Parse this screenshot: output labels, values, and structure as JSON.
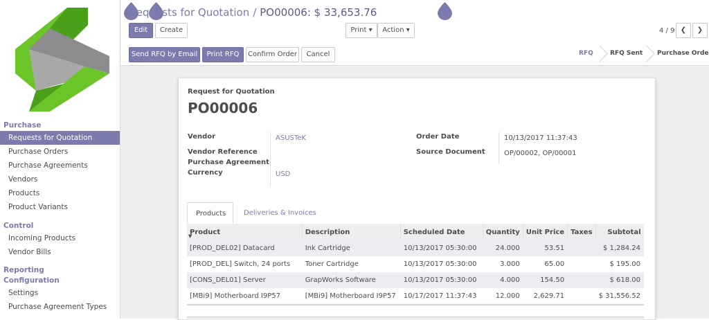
{
  "sidebar": {
    "sections": [
      {
        "title": "Purchase",
        "items": [
          {
            "label": "Requests for Quotation",
            "active": true
          },
          {
            "label": "Purchase Orders",
            "active": false
          },
          {
            "label": "Purchase Agreements",
            "active": false
          },
          {
            "label": "Vendors",
            "active": false
          },
          {
            "label": "Products",
            "active": false
          },
          {
            "label": "Product Variants",
            "active": false
          }
        ]
      },
      {
        "title": "Control",
        "items": [
          {
            "label": "Incoming Products",
            "active": false
          },
          {
            "label": "Vendor Bills",
            "active": false
          }
        ]
      },
      {
        "title": "Reporting",
        "items": []
      },
      {
        "title": "Configuration",
        "items": [
          {
            "label": "Settings",
            "active": false
          },
          {
            "label": "Purchase Agreement Types",
            "active": false
          }
        ]
      }
    ]
  },
  "breadcrumb": {
    "parent": "Requests for Quotation",
    "separator": "/",
    "current": "PO00006: $ 33,653.76"
  },
  "toolbar": {
    "edit": "Edit",
    "create": "Create",
    "print": "Print",
    "action": "Action",
    "pager": "4 / 9"
  },
  "actions": {
    "send_rfq": "Send RFQ by Email",
    "print_rfq": "Print RFQ",
    "confirm": "Confirm Order",
    "cancel": "Cancel"
  },
  "status": {
    "stages": [
      "RFQ",
      "RFQ Sent",
      "Purchase Order"
    ],
    "current": "RFQ"
  },
  "form": {
    "doc_type": "Request for Quotation",
    "name": "PO00006",
    "vendor_label": "Vendor",
    "vendor": "ASUSTeK",
    "vendor_ref_label": "Vendor Reference",
    "agreement_label": "Purchase Agreement",
    "currency_label": "Currency",
    "currency": "USD",
    "order_date_label": "Order Date",
    "order_date": "10/13/2017 11:37:43",
    "source_label": "Source Document",
    "source": "OP/00002, OP/00001"
  },
  "tabs": [
    {
      "label": "Products",
      "active": true
    },
    {
      "label": "Deliveries & Invoices",
      "active": false
    }
  ],
  "table": {
    "columns": [
      "Product",
      "Description",
      "Scheduled Date",
      "Quantity",
      "Unit Price",
      "Taxes",
      "Subtotal"
    ],
    "rows": [
      {
        "product": "[PROD_DEL02] Datacard",
        "description": "Ink Cartridge",
        "date": "10/13/2017 05:30:00",
        "qty": "24.000",
        "price": "53.51",
        "taxes": "",
        "subtotal": "$ 1,284.24"
      },
      {
        "product": "[PROD_DEL] Switch, 24 ports",
        "description": "Toner Cartridge",
        "date": "10/13/2017 05:30:00",
        "qty": "3.000",
        "price": "65.00",
        "taxes": "",
        "subtotal": "$ 195.00"
      },
      {
        "product": "[CONS_DEL01] Server",
        "description": "GrapWorks Software",
        "date": "10/13/2017 05:30:00",
        "qty": "4.000",
        "price": "154.50",
        "taxes": "",
        "subtotal": "$ 618.00"
      },
      {
        "product": "[MBi9] Motherboard I9P57",
        "description": "[MBi9] Motherboard I9P57",
        "date": "10/17/2017 11:37:43",
        "qty": "12.000",
        "price": "2,629.71",
        "taxes": "",
        "subtotal": "$ 31,556.52"
      }
    ]
  },
  "colors": {
    "accent": "#7c7bad",
    "logo_green": "#6cc528",
    "logo_gray": "#8c8c8c"
  }
}
